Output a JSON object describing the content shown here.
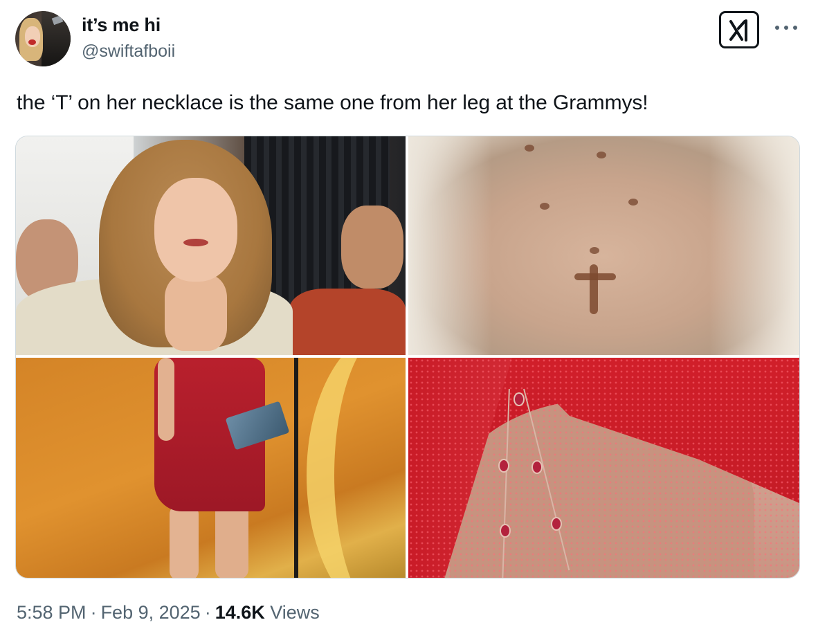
{
  "author": {
    "display_name": "it’s me hi",
    "handle": "@swiftafboii"
  },
  "tweet": {
    "text": "the ‘T’ on her necklace is the same one from her leg at the Grammys!"
  },
  "media": {
    "image_count": 4
  },
  "meta": {
    "time": "5:58 PM",
    "separator": "·",
    "date": "Feb 9, 2025",
    "views_count": "14.6K",
    "views_label": "Views"
  },
  "icons": {
    "logo": "xai-grok-icon",
    "menu": "more-horizontal-icon"
  },
  "colors": {
    "text_primary": "#0f1419",
    "text_secondary": "#536471",
    "border": "#cfd9de"
  }
}
